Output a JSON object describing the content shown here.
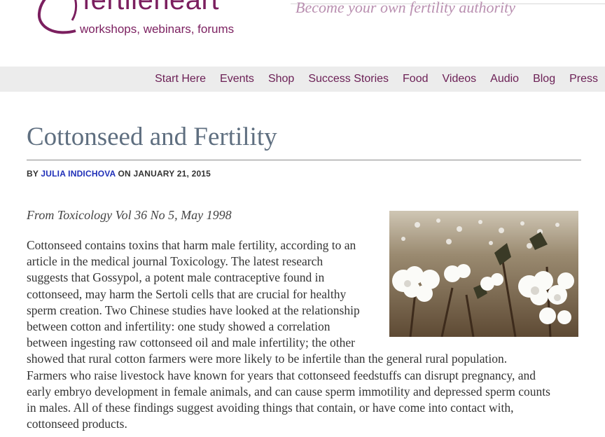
{
  "header": {
    "logo_word": "fertileheart",
    "logo_tagline": "workshops, webinars, forums",
    "site_tagline": "Become your own fertility authority"
  },
  "nav": {
    "items": [
      "Start Here",
      "Events",
      "Shop",
      "Success Stories",
      "Food",
      "Videos",
      "Audio",
      "Blog",
      "Press"
    ]
  },
  "article": {
    "title": "Cottonseed and Fertility",
    "byline_by": "BY",
    "author": "JULIA INDICHOVA",
    "byline_on": "ON",
    "date": "JANUARY 21, 2015",
    "source": "From Toxicology Vol 36 No 5, May 1998",
    "body_lines": [
      "Cottonseed contains toxins that harm male fertility, according to an",
      "article in the medical journal Toxicology. The latest research",
      "suggests that Gossypol, a potent male contraceptive found in",
      "cottonseed, may harm the Sertoli cells that are crucial for healthy",
      "sperm creation. Two Chinese studies have looked at the relationship",
      "between cotton and infertility: one study showed a correlation",
      "between ingesting raw cottonseed oil and male infertility; the other",
      "showed that rural cotton farmers were more likely to be infertile than the general rural population.",
      "Farmers who raise livestock have known for years that cottonseed feedstuffs can disrupt pregnancy, and",
      "early embryo development in female animals, and can cause sperm immotility and depressed sperm counts",
      "in males. All of these findings suggest avoiding things that contain, or have come into contact with,",
      "cottonseed products."
    ]
  },
  "colors": {
    "brand": "#7b1f5f",
    "nav_bg": "#ececec",
    "title": "#5f6f80",
    "author_link": "#1f2fb8"
  }
}
